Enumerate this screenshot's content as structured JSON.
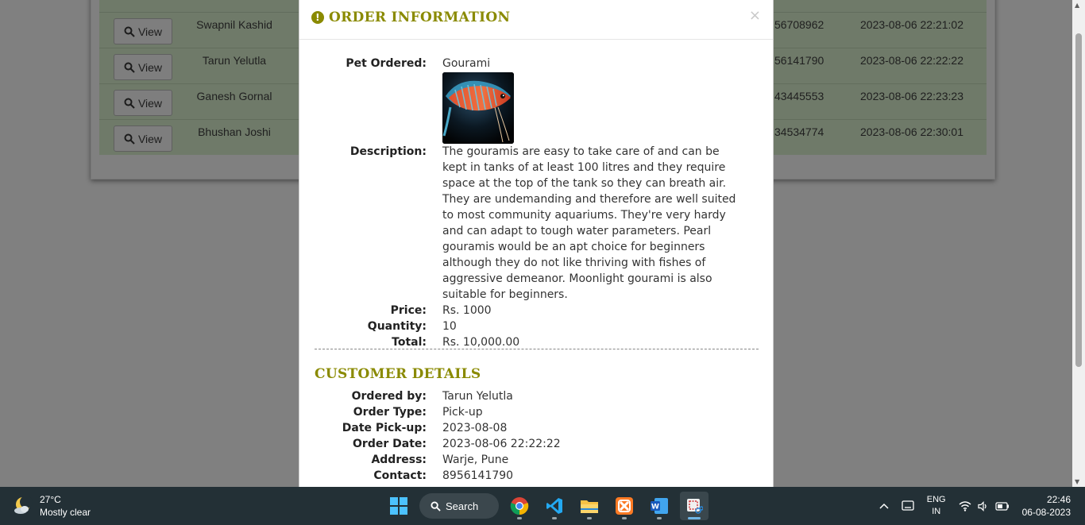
{
  "background_table": {
    "view_label": "View",
    "rows": [
      {
        "name": "Swapnil Kashid",
        "contact": "56708962",
        "date": "2023-08-06 22:21:02"
      },
      {
        "name": "Tarun Yelutla",
        "contact": "56141790",
        "date": "2023-08-06 22:22:22"
      },
      {
        "name": "Ganesh Gornal",
        "contact": "43445553",
        "date": "2023-08-06 22:23:23"
      },
      {
        "name": "Bhushan Joshi",
        "contact": "34534774",
        "date": "2023-08-06 22:30:01"
      }
    ]
  },
  "modal": {
    "title": "ORDER INFORMATION",
    "close": "×",
    "order": {
      "pet_label": "Pet Ordered:",
      "pet": "Gourami",
      "description_label": "Description:",
      "description": "The gouramis are easy to take care of and can be kept in tanks of at least 100 litres and they require space at the top of the tank so they can breath air. They are undemanding and therefore are well suited to most community aquariums. They're very hardy and can adapt to tough water parameters. Pearl gouramis would be an apt choice for beginners although they do not like thriving with fishes of aggressive demeanor. Moonlight gourami is also suitable for beginners.",
      "price_label": "Price:",
      "price": "Rs. 1000",
      "quantity_label": "Quantity:",
      "quantity": "10",
      "total_label": "Total:",
      "total": "Rs. 10,000.00"
    },
    "customer_title": "CUSTOMER DETAILS",
    "customer": {
      "ordered_by_label": "Ordered by:",
      "ordered_by": "Tarun Yelutla",
      "order_type_label": "Order Type:",
      "order_type": "Pick-up",
      "date_pickup_label": "Date Pick-up:",
      "date_pickup": "2023-08-08",
      "order_date_label": "Order Date:",
      "order_date": "2023-08-06 22:22:22",
      "address_label": "Address:",
      "address": "Warje, Pune",
      "contact_label": "Contact:",
      "contact": "8956141790"
    }
  },
  "taskbar": {
    "weather_temp": "27°C",
    "weather_desc": "Mostly clear",
    "search_label": "Search",
    "lang_top": "ENG",
    "lang_bottom": "IN",
    "time": "22:46",
    "date": "06-08-2023"
  },
  "colors": {
    "accent": "#8a8a00",
    "overlay_bg": "#808080",
    "taskbar_bg": "#233036"
  }
}
